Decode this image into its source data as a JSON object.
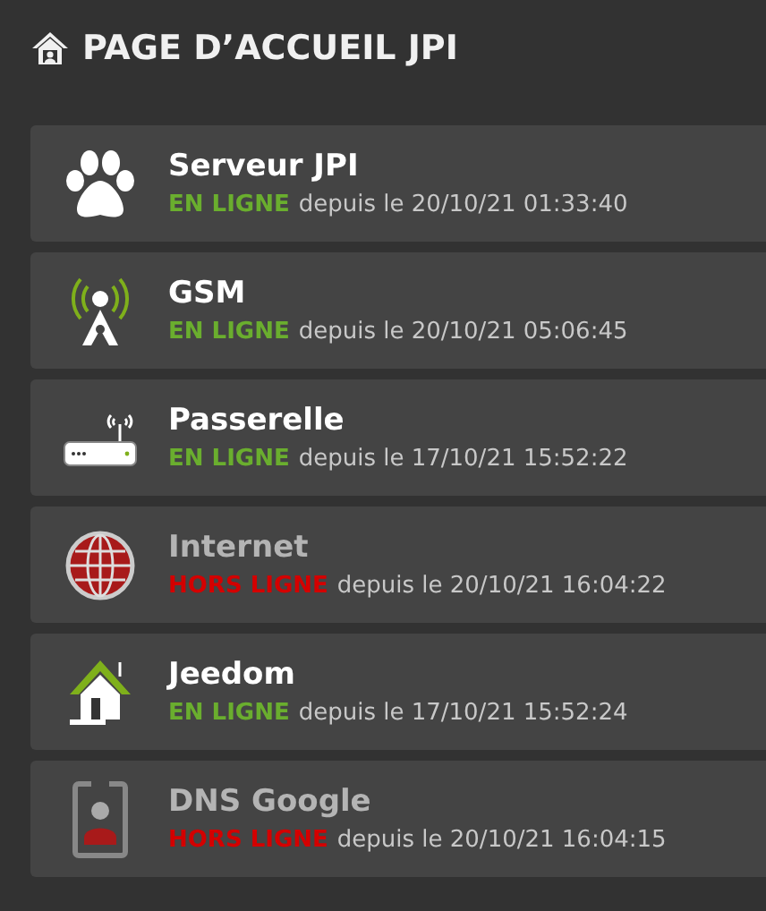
{
  "page_title": "PAGE D’ACCUEIL JPI",
  "devices": [
    {
      "kind": "paw",
      "name": "Serveur JPI",
      "online": true,
      "status": "EN LIGNE",
      "since": "depuis le 20/10/21 01:33:40"
    },
    {
      "kind": "antenna",
      "name": "GSM",
      "online": true,
      "status": "EN LIGNE",
      "since": "depuis le 20/10/21 05:06:45"
    },
    {
      "kind": "router",
      "name": "Passerelle",
      "online": true,
      "status": "EN LIGNE",
      "since": "depuis le 17/10/21 15:52:22"
    },
    {
      "kind": "globe",
      "name": "Internet",
      "online": false,
      "status": "HORS LIGNE",
      "since": "depuis le 20/10/21 16:04:22"
    },
    {
      "kind": "house",
      "name": "Jeedom",
      "online": true,
      "status": "EN LIGNE",
      "since": "depuis le 17/10/21 15:52:24"
    },
    {
      "kind": "badge",
      "name": "DNS Google",
      "online": false,
      "status": "HORS LIGNE",
      "since": "depuis le 20/10/21 16:04:15"
    }
  ]
}
